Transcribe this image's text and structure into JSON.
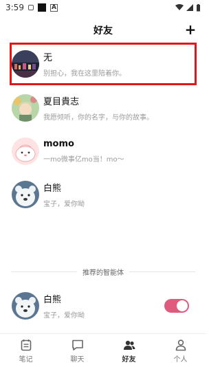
{
  "status_bar": {
    "time": "3:59",
    "icons": [
      "image-icon",
      "black-square-icon",
      "a-icon",
      "wifi-icon",
      "signal-icon",
      "battery-icon"
    ]
  },
  "header": {
    "title": "好友",
    "add_label": "+"
  },
  "friends": [
    {
      "name": "无",
      "subtitle": "别担心，我在这里陪着你。",
      "avatar": "night-city-avatar",
      "highlighted": true
    },
    {
      "name": "夏目貴志",
      "subtitle": "我愿倾听，你的名字，与你的故事。",
      "avatar": "anime-boy-avatar",
      "highlighted": false
    },
    {
      "name": "momo",
      "subtitle": "一mo微事亿mo当！mo～",
      "avatar": "pink-blob-avatar",
      "highlighted": false
    },
    {
      "name": "白熊",
      "subtitle": "宝子，爱你呦",
      "avatar": "white-bear-avatar",
      "highlighted": false
    }
  ],
  "recommended": {
    "section_label": "推荐的智能体",
    "agent": {
      "name": "白熊",
      "subtitle": "宝子，爱你呦",
      "avatar": "white-bear-avatar",
      "enabled": true
    }
  },
  "bottom_nav": {
    "items": [
      {
        "label": "笔记",
        "icon": "notebook-icon",
        "active": false
      },
      {
        "label": "聊天",
        "icon": "chat-bubble-icon",
        "active": false
      },
      {
        "label": "好友",
        "icon": "friends-icon",
        "active": true
      },
      {
        "label": "个人",
        "icon": "person-icon",
        "active": false
      }
    ]
  },
  "colors": {
    "highlight_border": "#e0161b",
    "toggle_on": "#e05a7d"
  }
}
